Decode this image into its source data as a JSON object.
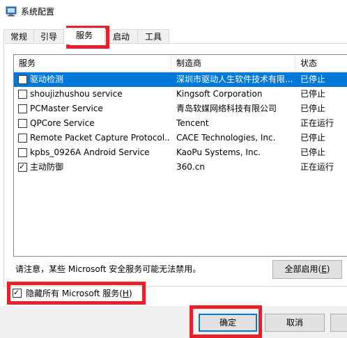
{
  "window": {
    "title": "系统配置",
    "icon": "msconfig-icon"
  },
  "tabs": [
    {
      "label": "常规",
      "active": false
    },
    {
      "label": "引导",
      "active": false
    },
    {
      "label": "服务",
      "active": true
    },
    {
      "label": "启动",
      "active": false
    },
    {
      "label": "工具",
      "active": false
    }
  ],
  "services_table": {
    "columns": [
      "服务",
      "制造商",
      "状态"
    ],
    "rows": [
      {
        "checked": false,
        "service": "驱动检测",
        "manufacturer": "深圳市驱动人生软件技术有限...",
        "status": "已停止",
        "selected": true
      },
      {
        "checked": false,
        "service": "shoujizhushou service",
        "manufacturer": "Kingsoft Corporation",
        "status": "已停止",
        "selected": false
      },
      {
        "checked": false,
        "service": "PCMaster Service",
        "manufacturer": "青岛软媒网络科技有限公司",
        "status": "已停止",
        "selected": false
      },
      {
        "checked": false,
        "service": "QPCore Service",
        "manufacturer": "Tencent",
        "status": "正在运行",
        "selected": false
      },
      {
        "checked": false,
        "service": "Remote Packet Capture Protocol...",
        "manufacturer": "CACE Technologies, Inc.",
        "status": "已停止",
        "selected": false
      },
      {
        "checked": false,
        "service": "kpbs_0926A Android Service",
        "manufacturer": "KaoPu Systems, Inc.",
        "status": "已停止",
        "selected": false
      },
      {
        "checked": true,
        "service": "主动防御",
        "manufacturer": "360.cn",
        "status": "正在运行",
        "selected": false
      }
    ]
  },
  "note": "请注意，某些 Microsoft 安全服务可能无法禁用。",
  "enable_all": {
    "label": "全部启用(",
    "key": "E",
    "suffix": ")"
  },
  "hide_ms": {
    "checked": true,
    "label": "隐藏所有 Microsoft 服务(",
    "key": "H",
    "suffix": ")"
  },
  "footer": {
    "ok_label": "确定",
    "cancel_label": "取消"
  },
  "colors": {
    "selection": "#0078d7",
    "highlight_box": "#e8202a"
  }
}
